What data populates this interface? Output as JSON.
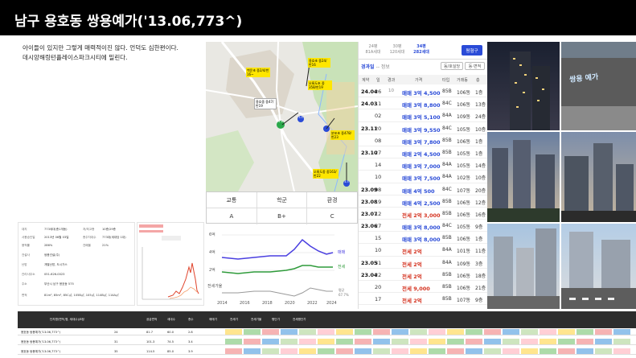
{
  "header": {
    "title": "남구 용호동 쌍용예가('13.06,773^)"
  },
  "description": {
    "line1": "아이들이 있지만 그렇게 매력적이진 않다. 언덕도 심한편이다.",
    "line2": "데시앙해링턴플레이스파크시티에 밀린다."
  },
  "map": {
    "labels": [
      {
        "name": "용호동",
        "text": "용호초 중24/반16"
      },
      {
        "name": "백운초",
        "text": "백운초 중2/4/반16~"
      },
      {
        "name": "오륙도초",
        "text": "오륙도초 중358/반19"
      },
      {
        "name": "용호중",
        "text": "용호중 중47/반19"
      },
      {
        "name": "분포초",
        "text": "분포초 중478/반23"
      },
      {
        "name": "오륙도중",
        "text": "오륙도중 중163/반22"
      },
      {
        "name": "badge1",
        "text": "4.2"
      },
      {
        "name": "badge2",
        "text": "3.5"
      },
      {
        "name": "badge3",
        "text": "4.5"
      }
    ]
  },
  "grades": {
    "headers": [
      "교통",
      "학군",
      "환경"
    ],
    "values": [
      "A",
      "B+",
      "C"
    ]
  },
  "info": {
    "rows": [
      {
        "k": "대지",
        "v": "773세대(총1개동)",
        "k2": "저/최고층",
        "v2": "10층/29층"
      },
      {
        "k": "사용승인일",
        "v": "2013년 06월 03일",
        "k2": "총주차대수",
        "v2": "773대(세대당 1대)"
      },
      {
        "k": "용적률",
        "v": "286%",
        "k2": "건폐율",
        "v2": "21%"
      },
      {
        "k": "건설사",
        "v": "쌍용건설(주)",
        "k2": "",
        "v2": ""
      },
      {
        "k": "난방",
        "v": "개별난방, 도시가스",
        "k2": "",
        "v2": ""
      },
      {
        "k": "관리사무소",
        "v": "051-626-0023",
        "k2": "",
        "v2": ""
      },
      {
        "k": "주소",
        "v": "부산시 남구 용호동 575",
        "k2": "",
        "v2": ""
      },
      {
        "k": "면적",
        "v": "81m², 85m², 85C㎡, 105B㎡, 105㎡, 114B㎡, 114A㎡",
        "k2": "",
        "v2": ""
      }
    ]
  },
  "price_chart": {
    "y_labels": [
      "6억",
      "4억",
      "2억"
    ],
    "x_labels": [
      "2014",
      "2016",
      "2018",
      "2020",
      "2022",
      "2024"
    ],
    "legend_trade": "매매",
    "legend_rent": "전세",
    "ratio_label": "전세가율",
    "ratio_value": "67.7%",
    "ratio_note": "평균"
  },
  "listing": {
    "tabs": [
      {
        "l1": "24평",
        "l2": "81A세대"
      },
      {
        "l1": "30평",
        "l2": "120세대"
      },
      {
        "l1": "34평",
        "l2": "282세대"
      }
    ],
    "compare_button": "평형구",
    "filter_title": "경과일",
    "filter_sub": "-- 정보",
    "filter_buttons": [
      "동/호실당",
      "동·면적"
    ],
    "columns": [
      "계약",
      "일",
      "경과",
      "가격",
      "타입",
      "거래동",
      "층"
    ],
    "rows": [
      {
        "ym": "24.04",
        "d": "26",
        "fl": "10",
        "price": "매매 3억 4,500",
        "kind": "trade",
        "area": "85B",
        "bld": "106동",
        "fn": "1층"
      },
      {
        "ym": "24.03",
        "d": "11",
        "fl": "",
        "price": "매매 3억 8,800",
        "kind": "trade",
        "area": "84C",
        "bld": "106동",
        "fn": "13층"
      },
      {
        "ym": "",
        "d": "02",
        "fl": "",
        "price": "매매 3억 5,100",
        "kind": "trade",
        "area": "84A",
        "bld": "109동",
        "fn": "24층"
      },
      {
        "ym": "23.11",
        "d": "20",
        "fl": "",
        "price": "매매 3억 9,550",
        "kind": "trade",
        "area": "84C",
        "bld": "105동",
        "fn": "10층"
      },
      {
        "ym": "",
        "d": "08",
        "fl": "",
        "price": "매매 3억 7,800",
        "kind": "trade",
        "area": "85B",
        "bld": "106동",
        "fn": "1층"
      },
      {
        "ym": "23.10",
        "d": "27",
        "fl": "",
        "price": "매매 2억 4,500",
        "kind": "trade",
        "area": "85B",
        "bld": "105동",
        "fn": "1층"
      },
      {
        "ym": "",
        "d": "14",
        "fl": "",
        "price": "매매 3억 7,000",
        "kind": "trade",
        "area": "84A",
        "bld": "105동",
        "fn": "14층"
      },
      {
        "ym": "",
        "d": "10",
        "fl": "",
        "price": "매매 3억 7,500",
        "kind": "trade",
        "area": "84A",
        "bld": "102동",
        "fn": "10층"
      },
      {
        "ym": "23.09",
        "d": "08",
        "fl": "",
        "price": "매매 4억 500",
        "kind": "trade",
        "area": "84C",
        "bld": "107동",
        "fn": "20층"
      },
      {
        "ym": "23.08",
        "d": "19",
        "fl": "",
        "price": "매매 4억 2,500",
        "kind": "trade",
        "area": "85B",
        "bld": "106동",
        "fn": "12층"
      },
      {
        "ym": "23.07",
        "d": "12",
        "fl": "",
        "price": "전세 2억 3,000",
        "kind": "rent",
        "area": "85B",
        "bld": "106동",
        "fn": "16층"
      },
      {
        "ym": "23.06",
        "d": "27",
        "fl": "",
        "price": "매매 3억 8,000",
        "kind": "trade",
        "area": "84C",
        "bld": "105동",
        "fn": "9층"
      },
      {
        "ym": "",
        "d": "15",
        "fl": "",
        "price": "매매 3억 8,000",
        "kind": "trade",
        "area": "85B",
        "bld": "106동",
        "fn": "1층"
      },
      {
        "ym": "",
        "d": "10",
        "fl": "",
        "price": "전세 2억",
        "kind": "rent",
        "area": "84A",
        "bld": "101동",
        "fn": "11층"
      },
      {
        "ym": "23.05",
        "d": "31",
        "fl": "",
        "price": "전세 2억",
        "kind": "rent",
        "area": "84A",
        "bld": "109동",
        "fn": "3층"
      },
      {
        "ym": "23.04",
        "d": "22",
        "fl": "",
        "price": "전세 2억",
        "kind": "rent",
        "area": "85B",
        "bld": "106동",
        "fn": "18층"
      },
      {
        "ym": "",
        "d": "20",
        "fl": "",
        "price": "전세 9,000",
        "kind": "rent",
        "area": "85B",
        "bld": "106동",
        "fn": "21층"
      },
      {
        "ym": "",
        "d": "17",
        "fl": "",
        "price": "전세 2억",
        "kind": "rent",
        "area": "85B",
        "bld": "107동",
        "fn": "9층"
      }
    ]
  },
  "photos": {
    "sign_text": "쌍용 예가"
  },
  "bottom_table": {
    "head_left": "단지명(면적,평, 세대수)/8정",
    "head_cols": [
      "공급면적",
      "세대수",
      "층수",
      "매매가",
      "전세가",
      "전세가율",
      "평단가",
      "전세평단가"
    ],
    "rows": [
      {
        "name": "용호동 쌍용예가('13.06,773^)",
        "c1": "24",
        "c2": "81.7",
        "c3": "60.0",
        "c4": "2.8"
      },
      {
        "name": "용호동 쌍용예가('13.06,773^)",
        "c1": "31",
        "c2": "101.3",
        "c3": "74.5",
        "c4": "3.4"
      },
      {
        "name": "용호동 쌍용예가('13.06,773^)",
        "c1": "35",
        "c2": "114.5",
        "c3": "85.0",
        "c4": "3.9"
      }
    ]
  },
  "colors": {
    "header_bg": "#000000",
    "trade": "#2a4bd7",
    "rent": "#d4321f",
    "label_yellow": "#ffe600",
    "chart_purple": "#4a3fe0",
    "chart_green": "#2f9b3b"
  }
}
